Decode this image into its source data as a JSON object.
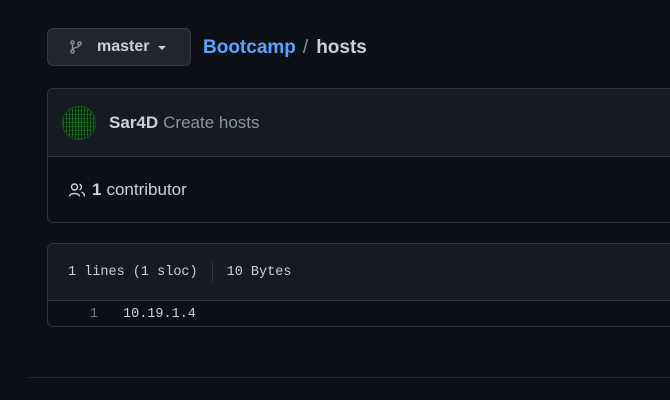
{
  "branch": {
    "name": "master",
    "icon": "git-branch-icon"
  },
  "breadcrumb": {
    "repo": "Bootcamp",
    "separator": "/",
    "file": "hosts"
  },
  "commit": {
    "author": "Sar4D",
    "message": "Create hosts",
    "avatar": "avatar-icon"
  },
  "contributors": {
    "icon": "people-icon",
    "count": "1",
    "label": "contributor"
  },
  "file": {
    "lines_info": "1 lines (1 sloc)",
    "size": "10 Bytes",
    "code_lines": [
      {
        "number": "1",
        "text": "10.19.1.4"
      }
    ]
  },
  "colors": {
    "background": "#0d1117",
    "header_bg": "#161b22",
    "border": "#30363d",
    "link": "#58a6ff",
    "text": "#c9d1d9",
    "muted": "#8b949e"
  }
}
